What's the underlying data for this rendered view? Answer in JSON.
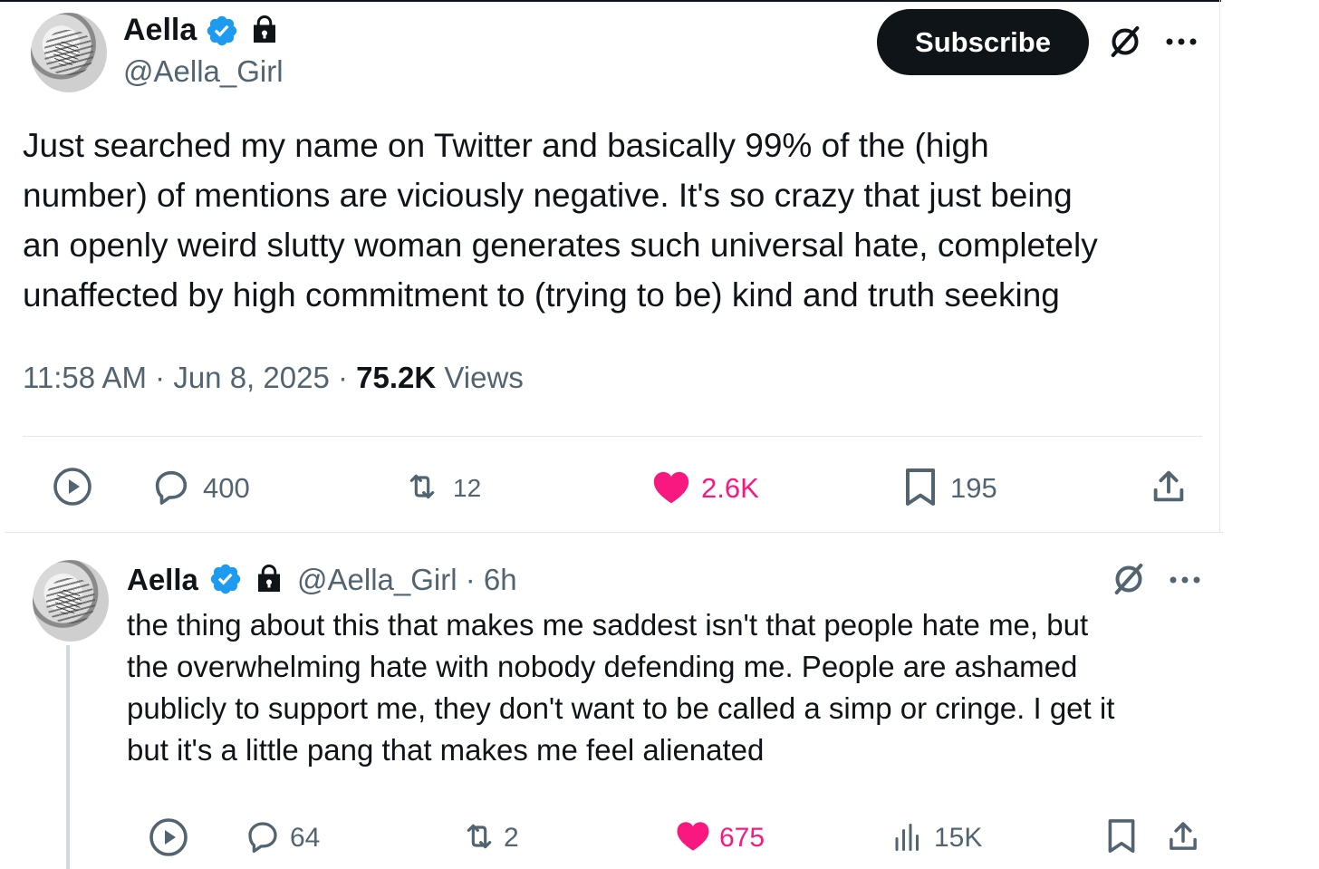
{
  "colors": {
    "text": "#0f1419",
    "muted": "#536471",
    "verified": "#1d9bf0",
    "like": "#f91880",
    "subscribe_bg": "#0f1419"
  },
  "main_post": {
    "author_name": "Aella",
    "handle": "@Aella_Girl",
    "subscribe_label": "Subscribe",
    "text_lines": [
      "Just searched my name on Twitter and basically 99% of the (high",
      "number) of mentions are viciously negative. It's so crazy that just being",
      "an openly weird slutty woman generates such universal hate, completely",
      "unaffected by high commitment to (trying to be) kind and truth seeking"
    ],
    "time": "11:58 AM",
    "date": "Jun 8, 2025",
    "views_count": "75.2K",
    "views_label": "Views",
    "stats": {
      "replies": "400",
      "reposts": "12",
      "likes": "2.6K",
      "bookmarks": "195"
    },
    "icons": [
      "verified-badge-icon",
      "lock-icon",
      "grok-icon",
      "more-icon",
      "play-icon",
      "reply-icon",
      "repost-icon",
      "like-icon",
      "bookmark-icon",
      "share-icon"
    ]
  },
  "reply_post": {
    "author_name": "Aella",
    "handle": "@Aella_Girl",
    "time_ago": "6h",
    "text_lines": [
      "the thing about this that makes me saddest isn't that people hate me, but",
      "the overwhelming hate with nobody defending me. People are ashamed",
      "publicly to support me, they don't want to be called a simp or cringe. I get it",
      "but it's a little pang that makes me feel alienated"
    ],
    "stats": {
      "replies": "64",
      "reposts": "2",
      "likes": "675",
      "views": "15K"
    },
    "icons": [
      "verified-badge-icon",
      "lock-icon",
      "grok-icon",
      "more-icon",
      "play-icon",
      "reply-icon",
      "repost-icon",
      "like-icon",
      "views-icon",
      "bookmark-icon",
      "share-icon"
    ]
  }
}
